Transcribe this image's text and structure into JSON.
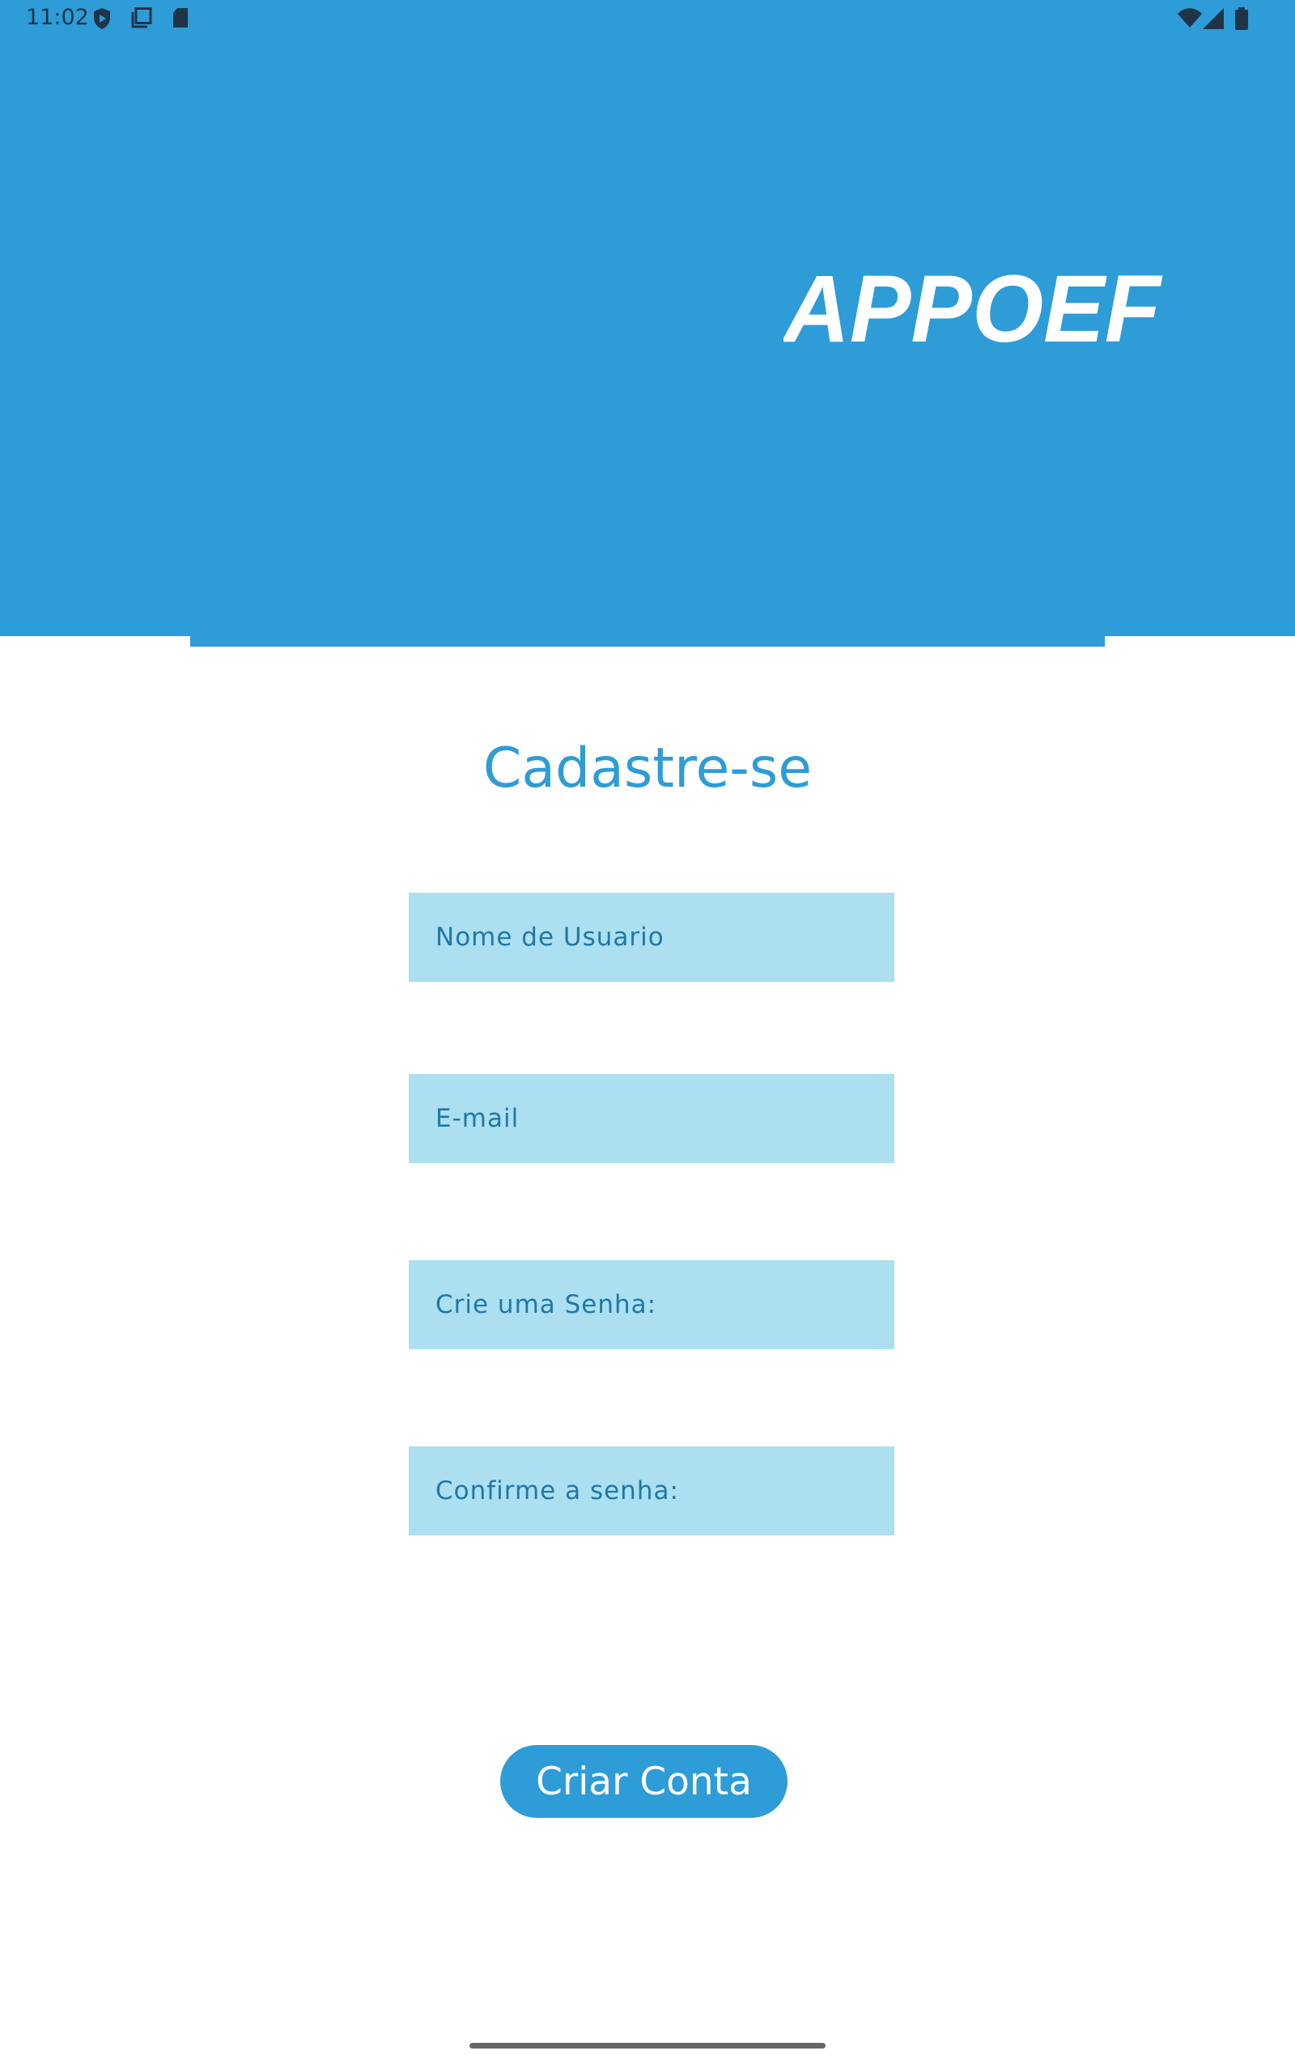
{
  "status_bar": {
    "time": "11:02",
    "left_icons": [
      "shield-play-icon",
      "screen-share-icon",
      "sd-card-icon"
    ],
    "right_icons": [
      "wifi-icon",
      "cellular-signal-icon",
      "battery-icon"
    ]
  },
  "header": {
    "logo_text": "APPOEF",
    "background_color": "#2e9cd6"
  },
  "form": {
    "title": "Cadastre-se",
    "fields": {
      "username": {
        "placeholder": "Nome de Usuario",
        "value": ""
      },
      "email": {
        "placeholder": "E-mail",
        "value": ""
      },
      "password": {
        "placeholder": "Crie uma Senha:",
        "value": ""
      },
      "confirm_password": {
        "placeholder": "Confirme a senha:",
        "value": ""
      }
    },
    "field_background_color": "#acdfef",
    "submit_label": "Criar Conta"
  },
  "colors": {
    "accent": "#2e9cd6",
    "field_text": "#1f78a8"
  }
}
